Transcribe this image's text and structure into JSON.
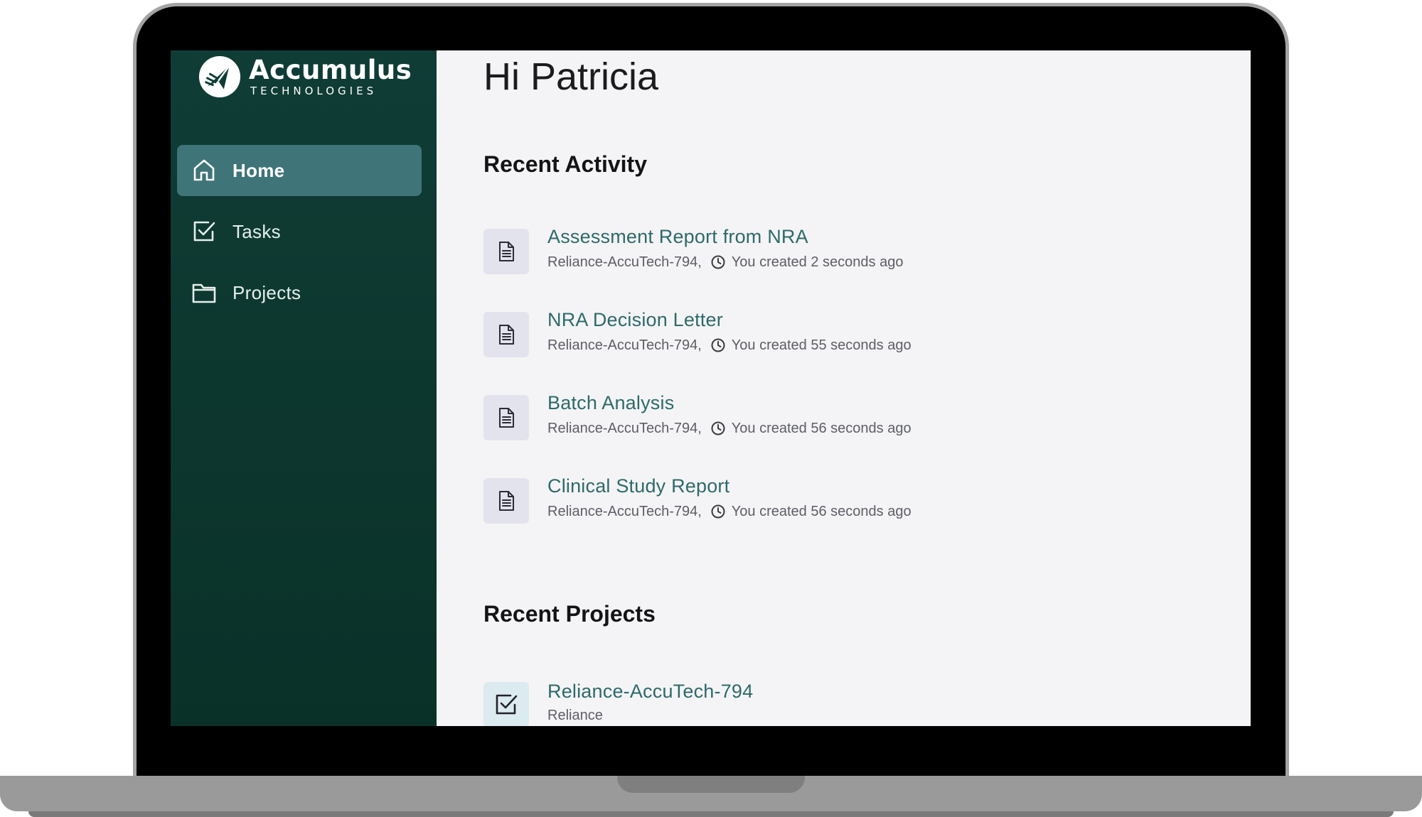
{
  "brand": {
    "name": "Accumulus",
    "tagline": "TECHNOLOGIES"
  },
  "sidebar": {
    "items": [
      {
        "label": "Home",
        "icon": "home-icon",
        "active": true
      },
      {
        "label": "Tasks",
        "icon": "checkbox-icon",
        "active": false
      },
      {
        "label": "Projects",
        "icon": "folder-icon",
        "active": false
      }
    ]
  },
  "main": {
    "greeting": "Hi Patricia",
    "recent_activity": {
      "title": "Recent Activity",
      "items": [
        {
          "title": "Assessment Report from NRA",
          "project": "Reliance-AccuTech-794,",
          "time": "You created 2 seconds ago"
        },
        {
          "title": "NRA Decision Letter",
          "project": "Reliance-AccuTech-794,",
          "time": "You created 55 seconds ago"
        },
        {
          "title": "Batch Analysis",
          "project": "Reliance-AccuTech-794,",
          "time": "You created 56 seconds ago"
        },
        {
          "title": "Clinical Study Report",
          "project": "Reliance-AccuTech-794,",
          "time": "You created 56 seconds ago"
        }
      ]
    },
    "recent_projects": {
      "title": "Recent Projects",
      "items": [
        {
          "title": "Reliance-AccuTech-794",
          "subtitle": "Reliance"
        }
      ]
    }
  },
  "colors": {
    "sidebar_bg": "#0f3d36",
    "nav_active": "#3f7478",
    "link": "#2e6a6a",
    "page_bg": "#f4f4f6"
  }
}
